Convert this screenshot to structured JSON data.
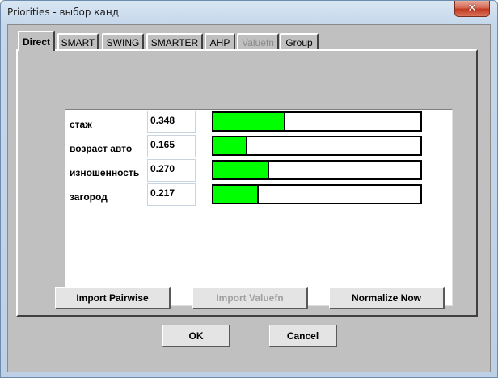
{
  "window": {
    "title": "Priorities - выбор канд",
    "close_glyph": "✕"
  },
  "tabs": [
    {
      "label": "Direct",
      "state": "active"
    },
    {
      "label": "SMART",
      "state": "normal"
    },
    {
      "label": "SWING",
      "state": "normal"
    },
    {
      "label": "SMARTER",
      "state": "normal"
    },
    {
      "label": "AHP",
      "state": "normal"
    },
    {
      "label": "Valuefn",
      "state": "disabled"
    },
    {
      "label": "Group",
      "state": "normal"
    }
  ],
  "priorities": [
    {
      "label": "стаж",
      "value": "0.348",
      "fraction": 0.348
    },
    {
      "label": "возраст авто",
      "value": "0.165",
      "fraction": 0.165
    },
    {
      "label": "изношенность",
      "value": "0.270",
      "fraction": 0.27
    },
    {
      "label": "загород",
      "value": "0.217",
      "fraction": 0.217
    }
  ],
  "actions": {
    "import_pairwise": "Import Pairwise",
    "import_valuefn": "Import Valuefn",
    "normalize_now": "Normalize Now"
  },
  "dialog": {
    "ok": "OK",
    "cancel": "Cancel"
  },
  "colors": {
    "bar_fill": "#00ff00",
    "panel": "#c0c0c0",
    "disabled_text": "#8a8a8a"
  }
}
